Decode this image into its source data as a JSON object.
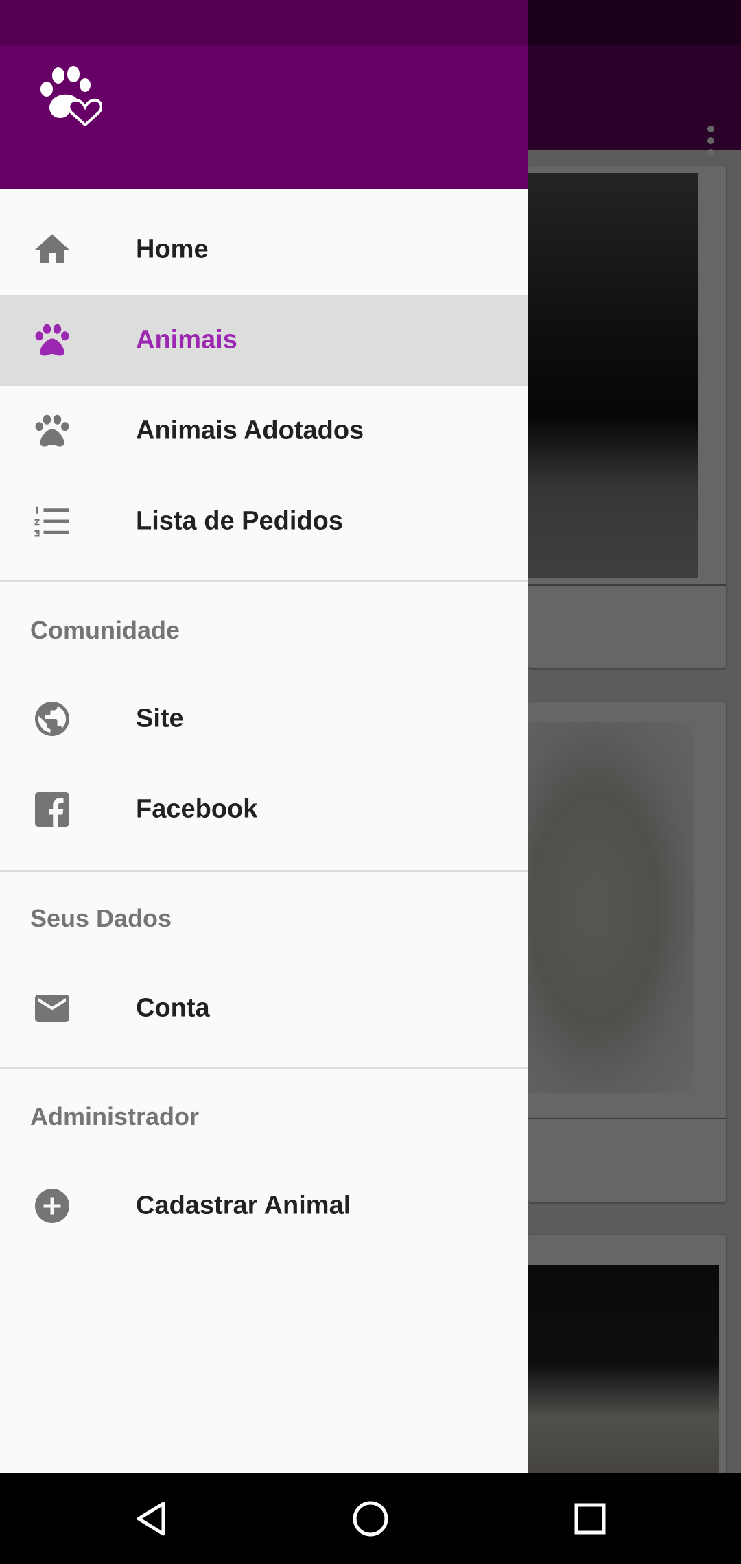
{
  "app": {
    "colors": {
      "primary": "#660066",
      "primary_dark": "#540052",
      "accent": "#9c27b0"
    },
    "overflow_icon": "more-vert-icon"
  },
  "drawer": {
    "header": {
      "logo_icon": "paw-heart-logo-icon"
    },
    "items": [
      {
        "label": "Home",
        "icon": "home-icon",
        "active": false
      },
      {
        "label": "Animais",
        "icon": "paw-icon",
        "active": true
      },
      {
        "label": "Animais Adotados",
        "icon": "paw-icon",
        "active": false
      },
      {
        "label": "Lista de Pedidos",
        "icon": "numbered-list-icon",
        "active": false
      }
    ],
    "sections": [
      {
        "title": "Comunidade",
        "items": [
          {
            "label": "Site",
            "icon": "globe-icon"
          },
          {
            "label": "Facebook",
            "icon": "facebook-icon"
          }
        ]
      },
      {
        "title": "Seus Dados",
        "items": [
          {
            "label": "Conta",
            "icon": "mail-icon"
          }
        ]
      },
      {
        "title": "Administrador",
        "items": [
          {
            "label": "Cadastrar Animal",
            "icon": "add-circle-icon"
          }
        ]
      }
    ]
  },
  "system_nav": {
    "buttons": [
      "back-icon",
      "home-circle-icon",
      "recents-icon"
    ]
  }
}
